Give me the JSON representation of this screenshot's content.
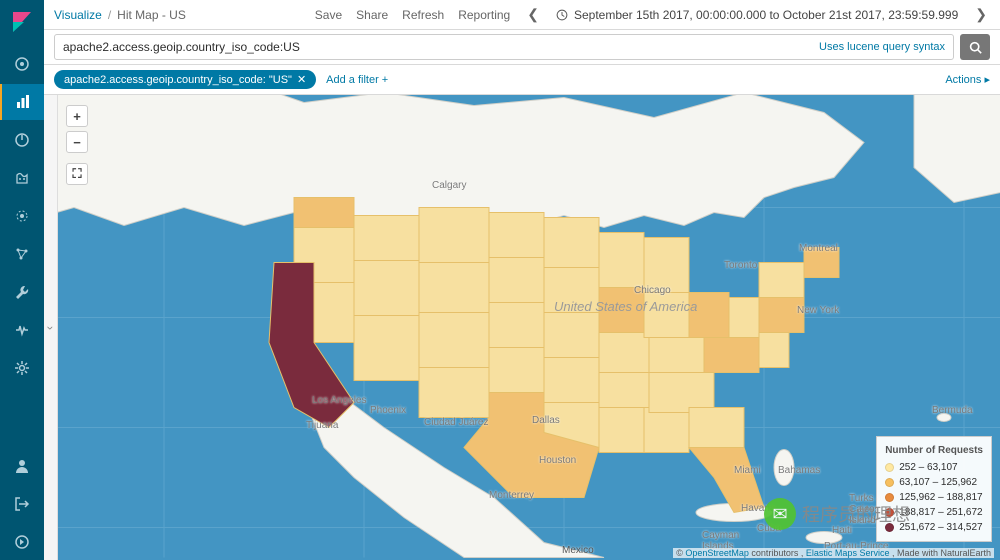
{
  "breadcrumb": {
    "root": "Visualize",
    "sep": "/",
    "current": "Hit Map - US"
  },
  "toolbar": {
    "save": "Save",
    "share": "Share",
    "refresh": "Refresh",
    "reporting": "Reporting"
  },
  "timerange": {
    "text": "September 15th 2017, 00:00:00.000 to October 21st 2017, 23:59:59.999"
  },
  "query": {
    "value": "apache2.access.geoip.country_iso_code:US",
    "hint": "Uses lucene query syntax"
  },
  "filter": {
    "pill": "apache2.access.geoip.country_iso_code: \"US\"",
    "add": "Add a filter +",
    "actions": "Actions ▸"
  },
  "legend": {
    "title": "Number of Requests",
    "items": [
      {
        "color": "#ffe8a0",
        "label": "252 – 63,107"
      },
      {
        "color": "#f7bf5e",
        "label": "63,107 – 125,962"
      },
      {
        "color": "#e88b3d",
        "label": "125,962 – 188,817"
      },
      {
        "color": "#c4513a",
        "label": "188,817 – 251,672"
      },
      {
        "color": "#7a2b3d",
        "label": "251,672 – 314,527"
      }
    ]
  },
  "attribution": {
    "osm": "OpenStreetMap",
    "contrib": " contributors , ",
    "ems": "Elastic Maps Service",
    "nat": " , Made with NaturalEarth",
    "copy": "© "
  },
  "cities": {
    "calgary": "Calgary",
    "toronto": "Toronto",
    "montreal": "Montreal",
    "chicago": "Chicago",
    "newyork": "New York",
    "losangeles": "Los Angeles",
    "phoenix": "Phoenix",
    "tijuana": "Tijuana",
    "ciudadjuarez": "Ciudad Juárez",
    "dallas": "Dallas",
    "houston": "Houston",
    "monterrey": "Monterrey",
    "mexico": "Mexico",
    "miami": "Miami",
    "havana": "Havana",
    "bahamas": "Bahamas",
    "bermuda": "Bermuda",
    "cuba": "Cuba",
    "haiti": "Haiti",
    "portauprince": "Port-au-Prince",
    "cayman": "Cayman\nIslands",
    "turks": "Turks and\nCaicos\nIslands",
    "usa": "United\nStates of\nAmerica"
  },
  "watermark": "程序员的理想",
  "nav": [
    "compass",
    "dashboard",
    "timelion",
    "face",
    "target",
    "graph",
    "wrench",
    "heart",
    "gear",
    "user",
    "login",
    "play"
  ],
  "chart_data": {
    "type": "choropleth-map",
    "metric": "Number of Requests",
    "geo_field": "apache2.access.geoip.country_iso_code",
    "filter_value": "US",
    "time_from": "2017-09-15T00:00:00.000",
    "time_to": "2017-10-21T23:59:59.999",
    "color_scale_bins": [
      {
        "from": 252,
        "to": 63107,
        "color": "#ffe8a0"
      },
      {
        "from": 63107,
        "to": 125962,
        "color": "#f7bf5e"
      },
      {
        "from": 125962,
        "to": 188817,
        "color": "#e88b3d"
      },
      {
        "from": 188817,
        "to": 251672,
        "color": "#c4513a"
      },
      {
        "from": 251672,
        "to": 314527,
        "color": "#7a2b3d"
      }
    ],
    "regions_approx": [
      {
        "region": "California",
        "bin": 5,
        "approx_range": "251,672 – 314,527"
      },
      {
        "region": "Texas",
        "bin": 2,
        "approx_range": "63,107 – 125,962"
      },
      {
        "region": "New York",
        "bin": 2,
        "approx_range": "63,107 – 125,962"
      },
      {
        "region": "Washington",
        "bin": 2,
        "approx_range": "63,107 – 125,962"
      },
      {
        "region": "Illinois",
        "bin": 2,
        "approx_range": "63,107 – 125,962"
      },
      {
        "region": "Virginia",
        "bin": 2,
        "approx_range": "63,107 – 125,962"
      },
      {
        "region": "Florida",
        "bin": 2,
        "approx_range": "63,107 – 125,962"
      },
      {
        "region": "Ohio",
        "bin": 2,
        "approx_range": "63,107 – 125,962"
      },
      {
        "region": "most other states",
        "bin": 1,
        "approx_range": "252 – 63,107"
      }
    ]
  }
}
